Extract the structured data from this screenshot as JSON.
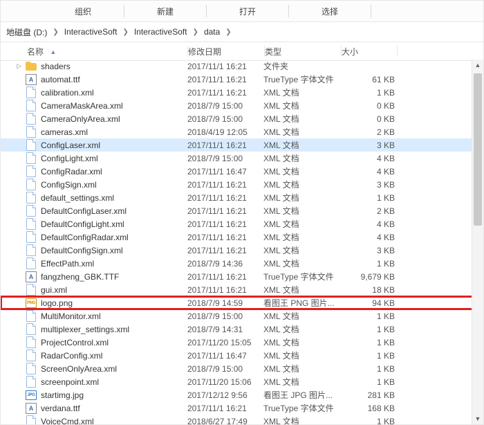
{
  "menu": {
    "items": [
      "组织",
      "新建",
      "打开",
      "选择"
    ]
  },
  "breadcrumb": {
    "drive": "地磁盘 (D:)",
    "parts": [
      "InteractiveSoft",
      "InteractiveSoft",
      "data"
    ]
  },
  "columns": {
    "name": "名称",
    "date": "修改日期",
    "type": "类型",
    "size": "大小"
  },
  "files": [
    {
      "icon": "folder",
      "name": "shaders",
      "date": "2017/11/1 16:21",
      "type": "文件夹",
      "size": "",
      "expandable": true
    },
    {
      "icon": "font",
      "name": "automat.ttf",
      "date": "2017/11/1 16:21",
      "type": "TrueType 字体文件",
      "size": "61 KB"
    },
    {
      "icon": "file",
      "name": "calibration.xml",
      "date": "2017/11/1 16:21",
      "type": "XML 文档",
      "size": "1 KB"
    },
    {
      "icon": "file",
      "name": "CameraMaskArea.xml",
      "date": "2018/7/9 15:00",
      "type": "XML 文档",
      "size": "0 KB"
    },
    {
      "icon": "file",
      "name": "CameraOnlyArea.xml",
      "date": "2018/7/9 15:00",
      "type": "XML 文档",
      "size": "0 KB"
    },
    {
      "icon": "file",
      "name": "cameras.xml",
      "date": "2018/4/19 12:05",
      "type": "XML 文档",
      "size": "2 KB"
    },
    {
      "icon": "file",
      "name": "ConfigLaser.xml",
      "date": "2017/11/1 16:21",
      "type": "XML 文档",
      "size": "3 KB",
      "selected": true
    },
    {
      "icon": "file",
      "name": "ConfigLight.xml",
      "date": "2018/7/9 15:00",
      "type": "XML 文档",
      "size": "4 KB"
    },
    {
      "icon": "file",
      "name": "ConfigRadar.xml",
      "date": "2017/11/1 16:47",
      "type": "XML 文档",
      "size": "4 KB"
    },
    {
      "icon": "file",
      "name": "ConfigSign.xml",
      "date": "2017/11/1 16:21",
      "type": "XML 文档",
      "size": "3 KB"
    },
    {
      "icon": "file",
      "name": "default_settings.xml",
      "date": "2017/11/1 16:21",
      "type": "XML 文档",
      "size": "1 KB"
    },
    {
      "icon": "file",
      "name": "DefaultConfigLaser.xml",
      "date": "2017/11/1 16:21",
      "type": "XML 文档",
      "size": "2 KB"
    },
    {
      "icon": "file",
      "name": "DefaultConfigLight.xml",
      "date": "2017/11/1 16:21",
      "type": "XML 文档",
      "size": "4 KB"
    },
    {
      "icon": "file",
      "name": "DefaultConfigRadar.xml",
      "date": "2017/11/1 16:21",
      "type": "XML 文档",
      "size": "4 KB"
    },
    {
      "icon": "file",
      "name": "DefaultConfigSign.xml",
      "date": "2017/11/1 16:21",
      "type": "XML 文档",
      "size": "3 KB"
    },
    {
      "icon": "file",
      "name": "EffectPath.xml",
      "date": "2018/7/9 14:36",
      "type": "XML 文档",
      "size": "1 KB"
    },
    {
      "icon": "font",
      "name": "fangzheng_GBK.TTF",
      "date": "2017/11/1 16:21",
      "type": "TrueType 字体文件",
      "size": "9,679 KB"
    },
    {
      "icon": "file",
      "name": "gui.xml",
      "date": "2017/11/1 16:21",
      "type": "XML 文档",
      "size": "18 KB"
    },
    {
      "icon": "png",
      "name": "logo.png",
      "date": "2018/7/9 14:59",
      "type": "看图王 PNG 图片...",
      "size": "94 KB",
      "highlight": true
    },
    {
      "icon": "file",
      "name": "MultiMonitor.xml",
      "date": "2018/7/9 15:00",
      "type": "XML 文档",
      "size": "1 KB"
    },
    {
      "icon": "file",
      "name": "multiplexer_settings.xml",
      "date": "2018/7/9 14:31",
      "type": "XML 文档",
      "size": "1 KB"
    },
    {
      "icon": "file",
      "name": "ProjectControl.xml",
      "date": "2017/11/20 15:05",
      "type": "XML 文档",
      "size": "1 KB"
    },
    {
      "icon": "file",
      "name": "RadarConfig.xml",
      "date": "2017/11/1 16:47",
      "type": "XML 文档",
      "size": "1 KB"
    },
    {
      "icon": "file",
      "name": "ScreenOnlyArea.xml",
      "date": "2018/7/9 15:00",
      "type": "XML 文档",
      "size": "1 KB"
    },
    {
      "icon": "file",
      "name": "screenpoint.xml",
      "date": "2017/11/20 15:06",
      "type": "XML 文档",
      "size": "1 KB"
    },
    {
      "icon": "jpg",
      "name": "startimg.jpg",
      "date": "2017/12/12 9:56",
      "type": "看图王 JPG 图片...",
      "size": "281 KB"
    },
    {
      "icon": "font",
      "name": "verdana.ttf",
      "date": "2017/11/1 16:21",
      "type": "TrueType 字体文件",
      "size": "168 KB"
    },
    {
      "icon": "file",
      "name": "VoiceCmd.xml",
      "date": "2018/6/27 17:49",
      "type": "XML 文档",
      "size": "1 KB"
    }
  ]
}
